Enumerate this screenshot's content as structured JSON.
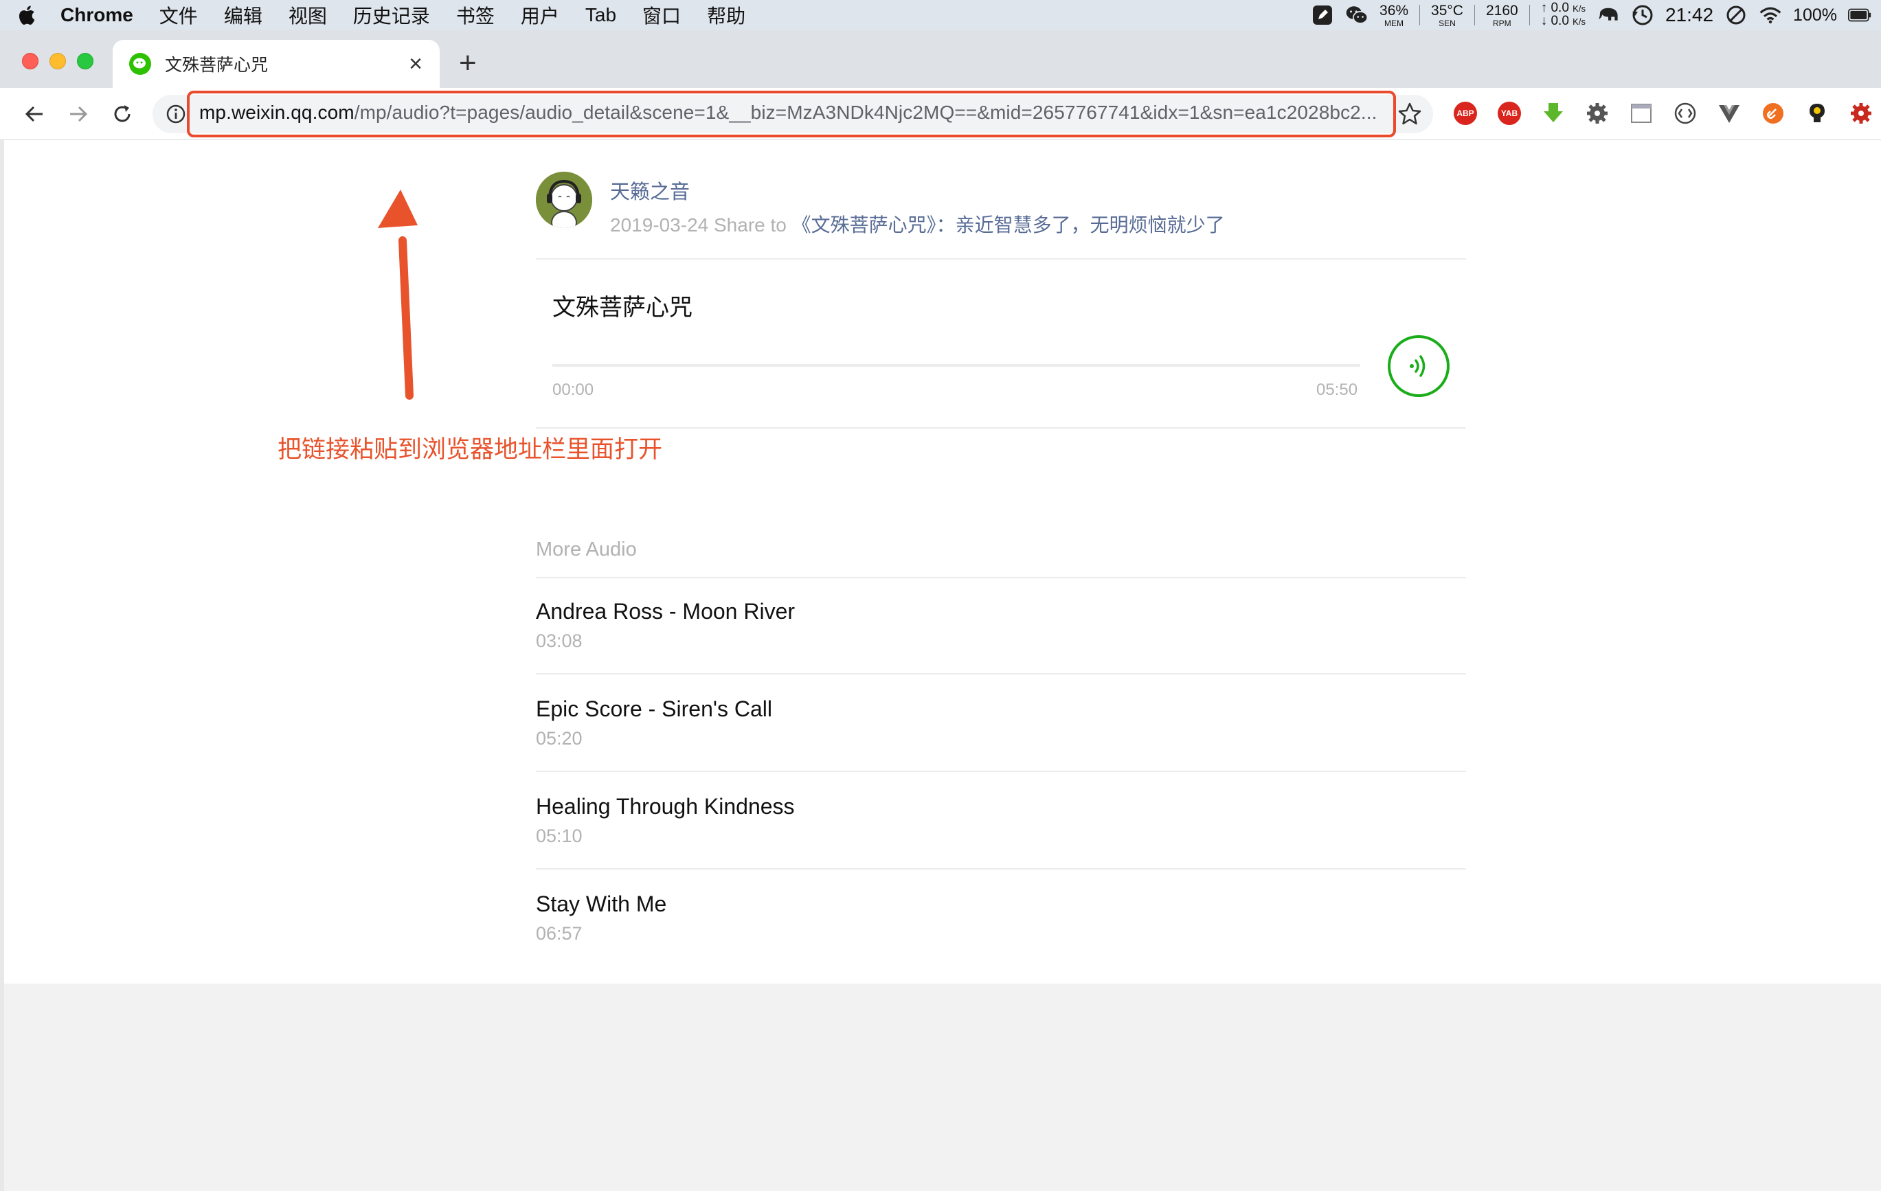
{
  "menubar": {
    "app_name": "Chrome",
    "items": [
      "文件",
      "编辑",
      "视图",
      "历史记录",
      "书签",
      "用户",
      "Tab",
      "窗口",
      "帮助"
    ],
    "status": {
      "mem_value": "36%",
      "mem_label": "MEM",
      "temp_value": "35°C",
      "temp_label": "SEN",
      "rpm_value": "2160",
      "rpm_label": "RPM",
      "net_up": "0.0",
      "net_down": "0.0",
      "net_unit": "K/s",
      "clock": "21:42",
      "battery": "100%"
    }
  },
  "browser": {
    "tab_title": "文殊菩萨心咒",
    "tab_close": "×",
    "new_tab": "+",
    "url_host": "mp.weixin.qq.com",
    "url_path": "/mp/audio?t=pages/audio_detail&scene=1&__biz=MzA3NDk4Njc2MQ==&mid=2657767741&idx=1&sn=ea1c2028bc2...",
    "extensions": [
      {
        "name": "adblock-plus-icon",
        "label": "ABP",
        "color": "#d9251d"
      },
      {
        "name": "youtube-ad-blocker-icon",
        "label": "YAB",
        "color": "#d9251d"
      }
    ]
  },
  "article": {
    "author_name": "天籁之音",
    "share_date": "2019-03-24 Share to ",
    "share_title": "《文殊菩萨心咒》：亲近智慧多了，无明烦恼就少了",
    "audio_title": "文殊菩萨心咒",
    "progress": 0.0,
    "time_start": "00:00",
    "time_end": "05:50",
    "accent_color": "#1aad19"
  },
  "annotation": {
    "text": "把链接粘贴到浏览器地址栏里面打开",
    "color": "#e8532c"
  },
  "more_audio": {
    "title": "More Audio",
    "items": [
      {
        "name": "Andrea Ross - Moon River",
        "duration": "03:08"
      },
      {
        "name": "Epic Score - Siren's Call",
        "duration": "05:20"
      },
      {
        "name": "Healing Through Kindness",
        "duration": "05:10"
      },
      {
        "name": "Stay With Me",
        "duration": "06:57"
      }
    ]
  }
}
